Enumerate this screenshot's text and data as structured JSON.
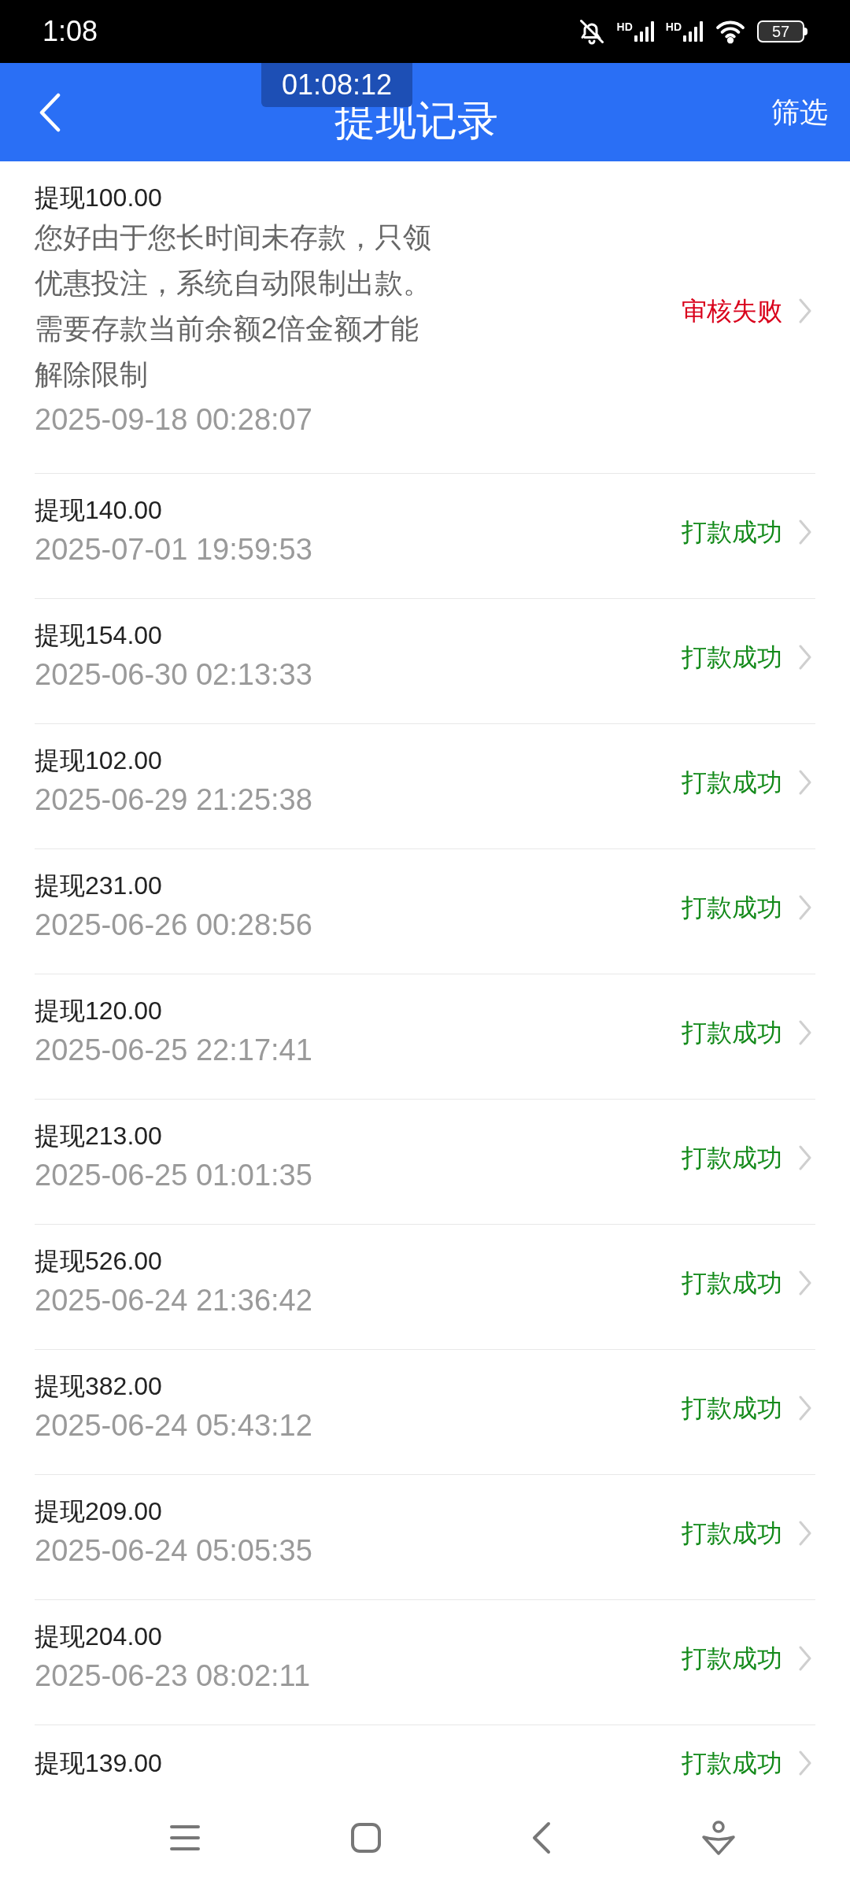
{
  "status_bar": {
    "time": "1:08",
    "signal_labels": [
      "HD",
      "HD"
    ],
    "battery": "57"
  },
  "recording_timer": "01:08:12",
  "header": {
    "title": "提现记录",
    "filter": "筛选"
  },
  "records": [
    {
      "title": "提现100.00",
      "note_lines": [
        "您好由于您长时间未存款，只领",
        "优惠投注，系统自动限制出款。",
        "需要存款当前余额2倍金额才能",
        "解除限制"
      ],
      "date": "2025-09-18 00:28:07",
      "status": "审核失败",
      "kind": "failed"
    },
    {
      "title": "提现140.00",
      "date": "2025-07-01 19:59:53",
      "status": "打款成功",
      "kind": "success"
    },
    {
      "title": "提现154.00",
      "date": "2025-06-30 02:13:33",
      "status": "打款成功",
      "kind": "success"
    },
    {
      "title": "提现102.00",
      "date": "2025-06-29 21:25:38",
      "status": "打款成功",
      "kind": "success"
    },
    {
      "title": "提现231.00",
      "date": "2025-06-26 00:28:56",
      "status": "打款成功",
      "kind": "success"
    },
    {
      "title": "提现120.00",
      "date": "2025-06-25 22:17:41",
      "status": "打款成功",
      "kind": "success"
    },
    {
      "title": "提现213.00",
      "date": "2025-06-25 01:01:35",
      "status": "打款成功",
      "kind": "success"
    },
    {
      "title": "提现526.00",
      "date": "2025-06-24 21:36:42",
      "status": "打款成功",
      "kind": "success"
    },
    {
      "title": "提现382.00",
      "date": "2025-06-24 05:43:12",
      "status": "打款成功",
      "kind": "success"
    },
    {
      "title": "提现209.00",
      "date": "2025-06-24 05:05:35",
      "status": "打款成功",
      "kind": "success"
    },
    {
      "title": "提现204.00",
      "date": "2025-06-23 08:02:11",
      "status": "打款成功",
      "kind": "success"
    },
    {
      "title": "提现139.00",
      "status": "打款成功",
      "kind": "success"
    }
  ]
}
